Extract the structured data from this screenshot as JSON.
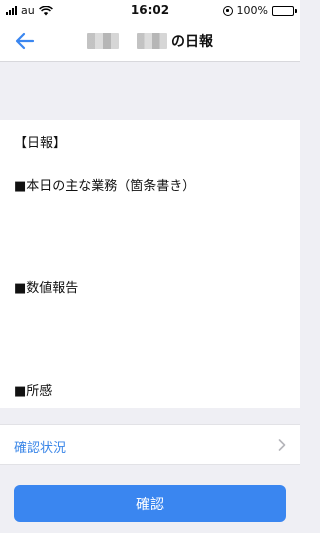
{
  "status_bar": {
    "carrier": "au",
    "time": "16:02",
    "battery": "100%"
  },
  "nav": {
    "title": "の日報",
    "back_icon": "arrow-left-icon"
  },
  "report": {
    "heading": "【日報】",
    "sections": [
      "■本日の主な業務（箇条書き）",
      "■数値報告",
      "■所感"
    ]
  },
  "status_row": {
    "label": "確認状況",
    "icon": "chevron-right-icon"
  },
  "footer": {
    "confirm_label": "確認"
  },
  "colors": {
    "accent": "#3a86f0",
    "link": "#3a86e8",
    "background": "#efeff4"
  }
}
